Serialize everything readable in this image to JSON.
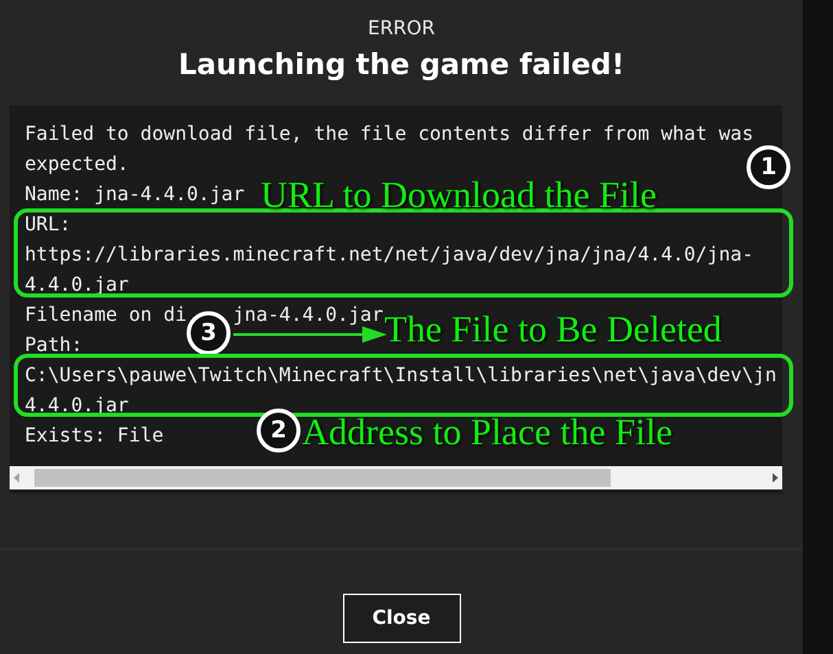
{
  "dialog": {
    "caption": "ERROR",
    "title": "Launching the game failed!"
  },
  "log_lines": [
    {
      "parts": [
        "Failed to download file, the file contents differ from what was"
      ]
    },
    {
      "parts": [
        "expected."
      ]
    },
    {
      "parts": [
        "Name: jna-4.4.0.jar"
      ]
    },
    {
      "parts": [
        "URL:"
      ]
    },
    {
      "parts": [
        "https://libraries.minecraft.net/net/java/dev/jna/jna/4.4.0/jna-"
      ]
    },
    {
      "parts": [
        "4.4.0.jar"
      ]
    },
    {
      "parts": [
        "Filename on di",
        "jna-4.4.0.jar"
      ]
    },
    {
      "parts": [
        "Path:"
      ]
    },
    {
      "parts": [
        "C:\\Users\\pauwe\\Twitch\\Minecraft\\Install\\libraries\\net\\java\\dev\\jn"
      ]
    },
    {
      "parts": [
        "4.4.0.jar"
      ]
    },
    {
      "parts": [
        "Exists: File"
      ]
    }
  ],
  "annotations": [
    {
      "number": "1",
      "label": "URL to Download the File"
    },
    {
      "number": "3",
      "label": "The File to Be Deleted"
    },
    {
      "number": "2",
      "label": "Address to Place the File"
    }
  ],
  "buttons": [
    "Close"
  ]
}
